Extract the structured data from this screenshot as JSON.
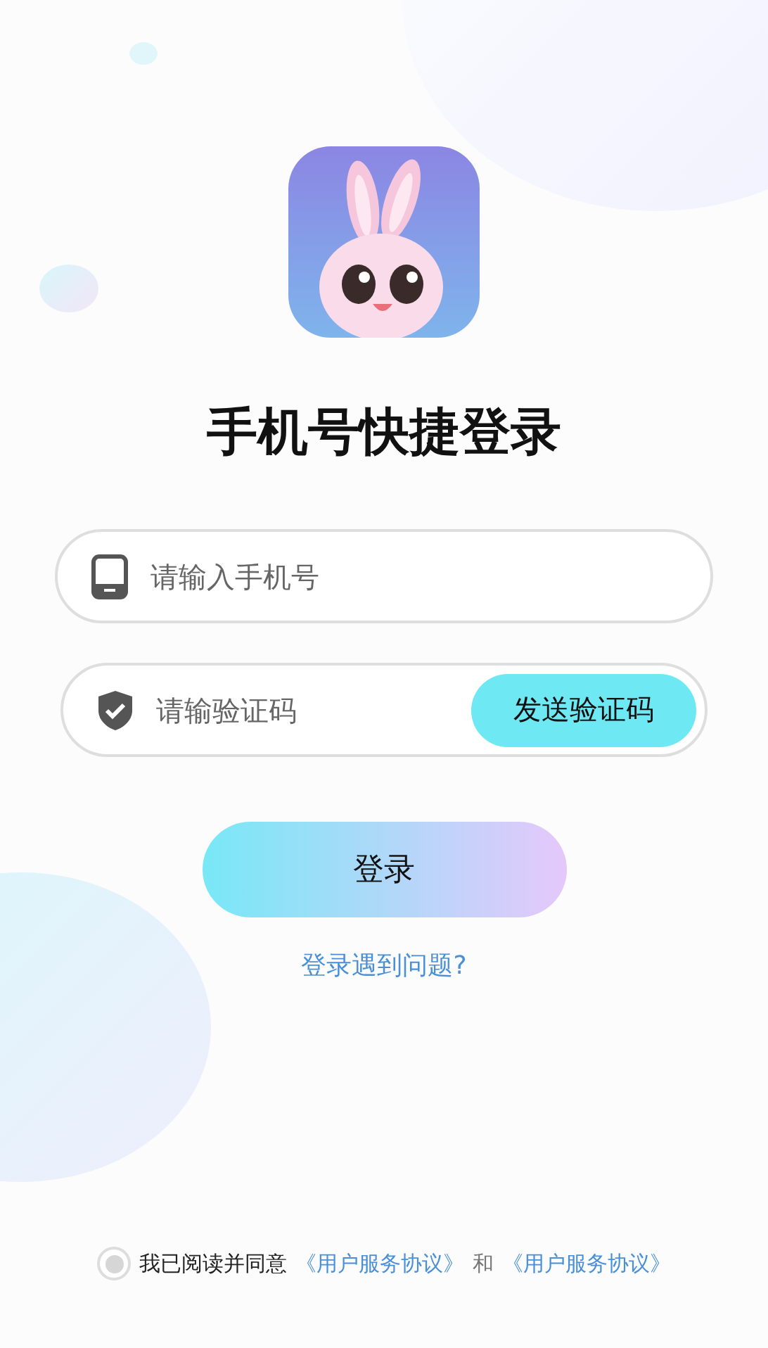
{
  "title": "手机号快捷登录",
  "phone_field": {
    "placeholder": "请输入手机号"
  },
  "code_field": {
    "placeholder": "请输验证码",
    "send_button": "发送验证码"
  },
  "login_button": "登录",
  "help_link": "登录遇到问题?",
  "agreement": {
    "checked": false,
    "text": "我已阅读并同意",
    "link_1": "《用户服务协议》",
    "joiner": "和",
    "link_2": "《用户服务协议》"
  }
}
